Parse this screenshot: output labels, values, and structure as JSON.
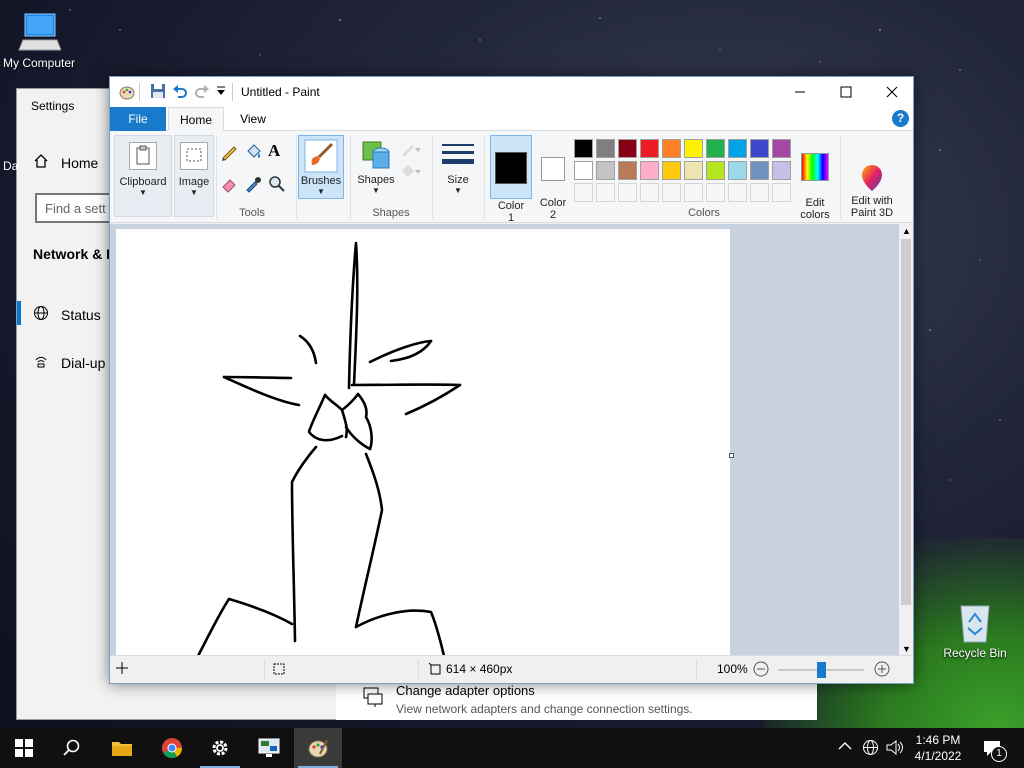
{
  "desktop": {
    "icons": [
      {
        "label": "My Computer"
      },
      {
        "label": "Recycle Bin"
      }
    ]
  },
  "settings": {
    "title": "Settings",
    "home_label": "Home",
    "search_placeholder": "Find a sett",
    "section_title": "Network & I",
    "partial_left_text": "Da",
    "nav": [
      {
        "label": "Status",
        "icon": "globe-icon"
      },
      {
        "label": "Dial-up",
        "icon": "dialup-icon"
      }
    ],
    "adapter": {
      "title": "Change adapter options",
      "subtitle": "View network adapters and change connection settings."
    }
  },
  "paint": {
    "caption": "Untitled - Paint",
    "tabs": {
      "file": "File",
      "home": "Home",
      "view": "View"
    },
    "groups": {
      "clipboard": "Clipboard",
      "image": "Image",
      "tools": "Tools",
      "brushes": "Brushes",
      "shapes": "Shapes",
      "shapes_group": "Shapes",
      "size": "Size",
      "color1": "Color\n1",
      "color2": "Color\n2",
      "colors_group": "Colors",
      "edit_colors": "Edit\ncolors",
      "paint3d": "Edit with\nPaint 3D"
    },
    "palette_row1": [
      "#000000",
      "#7f7f7f",
      "#880015",
      "#ed1c24",
      "#ff7f27",
      "#fff200",
      "#22b14c",
      "#00a2e8",
      "#3f48cc",
      "#a349a4"
    ],
    "palette_row2": [
      "#ffffff",
      "#c3c3c3",
      "#b97a57",
      "#ffaec9",
      "#ffc90e",
      "#efe4b0",
      "#b5e61d",
      "#99d9ea",
      "#7092be",
      "#c8bfe7"
    ],
    "color1_value": "#000000",
    "color2_value": "#ffffff",
    "status": {
      "canvas_size": "614 × 460px",
      "zoom": "100%",
      "zoom_level": 0.5
    }
  },
  "taskbar": {
    "time": "1:46 PM",
    "date": "4/1/2022",
    "notification_count": "1"
  }
}
